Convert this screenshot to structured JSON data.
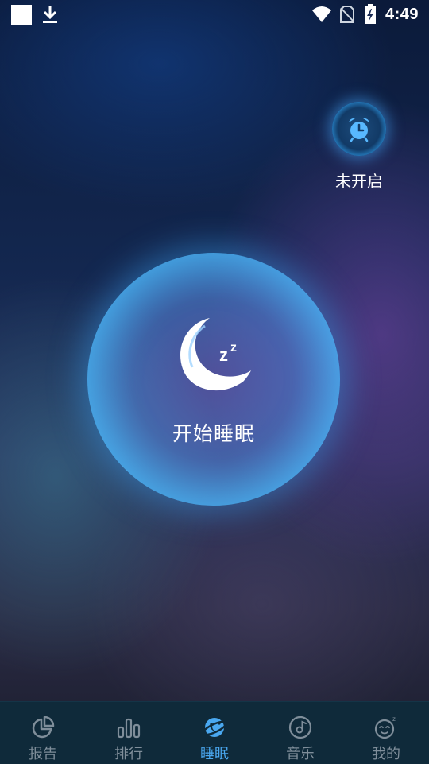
{
  "status_bar": {
    "time": "4:49",
    "icons": [
      "notification-square-icon",
      "download-icon",
      "wifi-icon",
      "no-sim-icon",
      "battery-charging-icon"
    ]
  },
  "alarm": {
    "icon": "alarm-clock-icon",
    "status_label": "未开启"
  },
  "sleep_button": {
    "icon": "moon-zzz-icon",
    "label": "开始睡眠"
  },
  "bottom_nav": {
    "active_index": 2,
    "items": [
      {
        "label": "报告",
        "icon": "pie-chart-icon"
      },
      {
        "label": "排行",
        "icon": "bar-chart-icon"
      },
      {
        "label": "睡眠",
        "icon": "sleep-planet-icon"
      },
      {
        "label": "音乐",
        "icon": "music-disc-icon"
      },
      {
        "label": "我的",
        "icon": "sleepy-face-icon"
      }
    ]
  },
  "colors": {
    "accent": "#4aa8f0",
    "nav_inactive": "#7f8e9a",
    "nav_background": "#0f2a3a",
    "glow": "#5cc4ff"
  }
}
